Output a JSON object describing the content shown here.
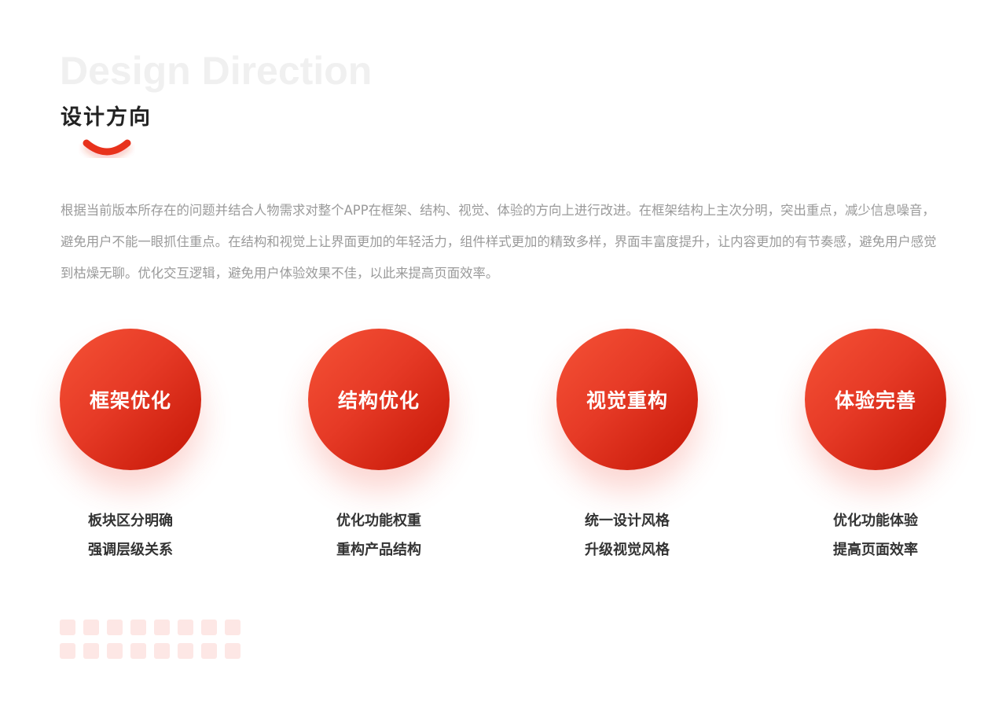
{
  "header": {
    "title_en": "Design Direction",
    "title_cn": "设计方向"
  },
  "intro": {
    "text": "根据当前版本所存在的问题并结合人物需求对整个APP在框架、结构、视觉、体验的方向上进行改进。在框架结构上主次分明，突出重点，减少信息噪音，避免用户不能一眼抓住重点。在结构和视觉上让界面更加的年轻活力，组件样式更加的精致多样，界面丰富度提升，让内容更加的有节奏感，避免用户感觉到枯燥无聊。优化交互逻辑，避免用户体验效果不佳，以此来提高页面效率。"
  },
  "directions": [
    {
      "label": "框架优化",
      "points": [
        "板块区分明确",
        "强调层级关系"
      ]
    },
    {
      "label": "结构优化",
      "points": [
        "优化功能权重",
        "重构产品结构"
      ]
    },
    {
      "label": "视觉重构",
      "points": [
        "统一设计风格",
        "升级视觉风格"
      ]
    },
    {
      "label": "体验完善",
      "points": [
        "优化功能体验",
        "提高页面效率"
      ]
    }
  ],
  "colors": {
    "accent": "#e8311d",
    "accent_dark": "#c41505",
    "deco": "#fde7e5",
    "title_bg": "#f0f0f0",
    "title": "#222222",
    "body_text": "#9a9a9a",
    "point_text": "#333333"
  },
  "decoration": {
    "icon": "smile-curve-icon",
    "pattern": "square-grid-pattern"
  }
}
